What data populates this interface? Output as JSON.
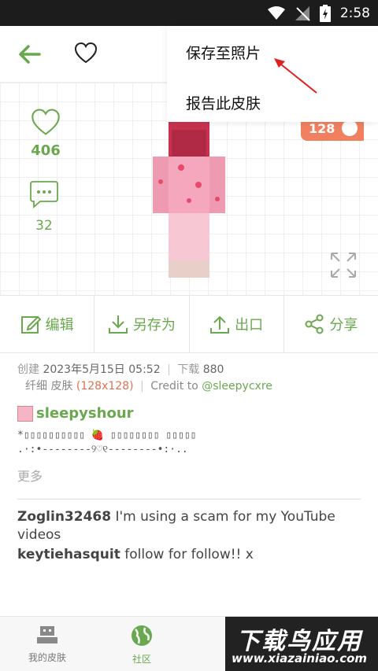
{
  "status_bar": {
    "time": "2:58"
  },
  "menu": {
    "save_to_photos": "保存至照片",
    "report_skin": "报告此皮肤"
  },
  "preview": {
    "likes": "406",
    "comments": "32",
    "resolution_badge": "128"
  },
  "actions": [
    {
      "label": "编辑",
      "icon": "edit-icon"
    },
    {
      "label": "另存为",
      "icon": "download-icon"
    },
    {
      "label": "出口",
      "icon": "upload-icon"
    },
    {
      "label": "分享",
      "icon": "share-icon"
    }
  ],
  "meta": {
    "created_label": "创建",
    "created_date": "2023年5月15日 05:52",
    "downloads_label": "下载",
    "downloads": "880",
    "type": "纤细 皮肤",
    "resolution": "(128x128)",
    "credit_label": "Credit to",
    "credit_user": "@sleepycxre"
  },
  "author": {
    "name": "sleepyshour"
  },
  "description": {
    "line1": "*▯▯▯▯▯▯▯▯▯▯ 🍓 ▯▯▯▯▯▯▯▯ ▯▯▯▯▯",
    "line2": ".·:•--------୨♡୧--------•:·.."
  },
  "more_label": "更多",
  "comments": [
    {
      "user": "Zoglin32468",
      "text": "I'm using a scam for my YouTube videos"
    },
    {
      "user": "keytiehasquit",
      "text": "follow for follow!! x"
    }
  ],
  "bottom_nav": {
    "my_skins": "我的皮肤",
    "community": "社区"
  },
  "watermark": {
    "title": "下载鸟应用",
    "url": "www.xiazainiao.com"
  },
  "colors": {
    "accent": "#6aa84f",
    "badge": "#f08060"
  }
}
